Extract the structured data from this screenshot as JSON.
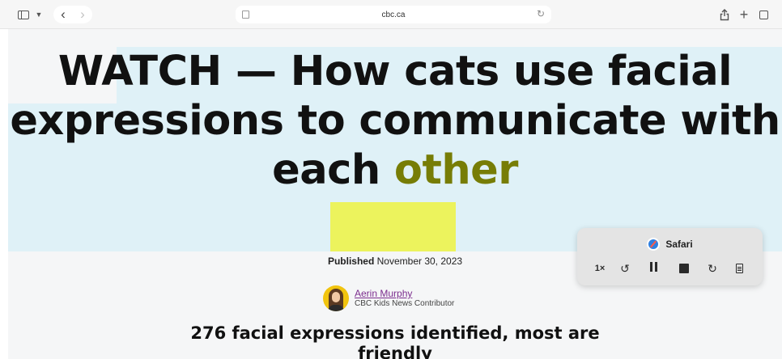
{
  "browser": {
    "url": "cbc.ca",
    "icons": {
      "sidebar": "sidebar-icon",
      "chevron": "chevron-down-icon",
      "back": "back-arrow-icon",
      "forward": "forward-arrow-icon",
      "reader": "reader-icon",
      "reload": "reload-icon",
      "share": "share-icon",
      "new_tab": "plus-icon",
      "tabs": "tab-overview-icon"
    }
  },
  "article": {
    "headline_main": "WATCH — How cats use facial expressions to communicate with each ",
    "headline_last": "other",
    "published_label": "Published",
    "published_date": "November 30, 2023",
    "author_name": "Aerin Murphy",
    "author_role": "CBC Kids News Contributor",
    "subheadline_1": "276 facial expressions identified, most are",
    "subheadline_2": "friendly"
  },
  "speech_controller": {
    "app_name": "Safari",
    "rate": "1×",
    "icons": [
      "safari-icon",
      "skip-back-icon",
      "pause-icon",
      "stop-icon",
      "skip-forward-icon",
      "document-icon"
    ]
  },
  "colors": {
    "line_highlight": "#dff1f7",
    "word_highlight": "#ecf35d",
    "highlighted_word_text": "#777d06",
    "author_link": "#7b2d8e"
  }
}
